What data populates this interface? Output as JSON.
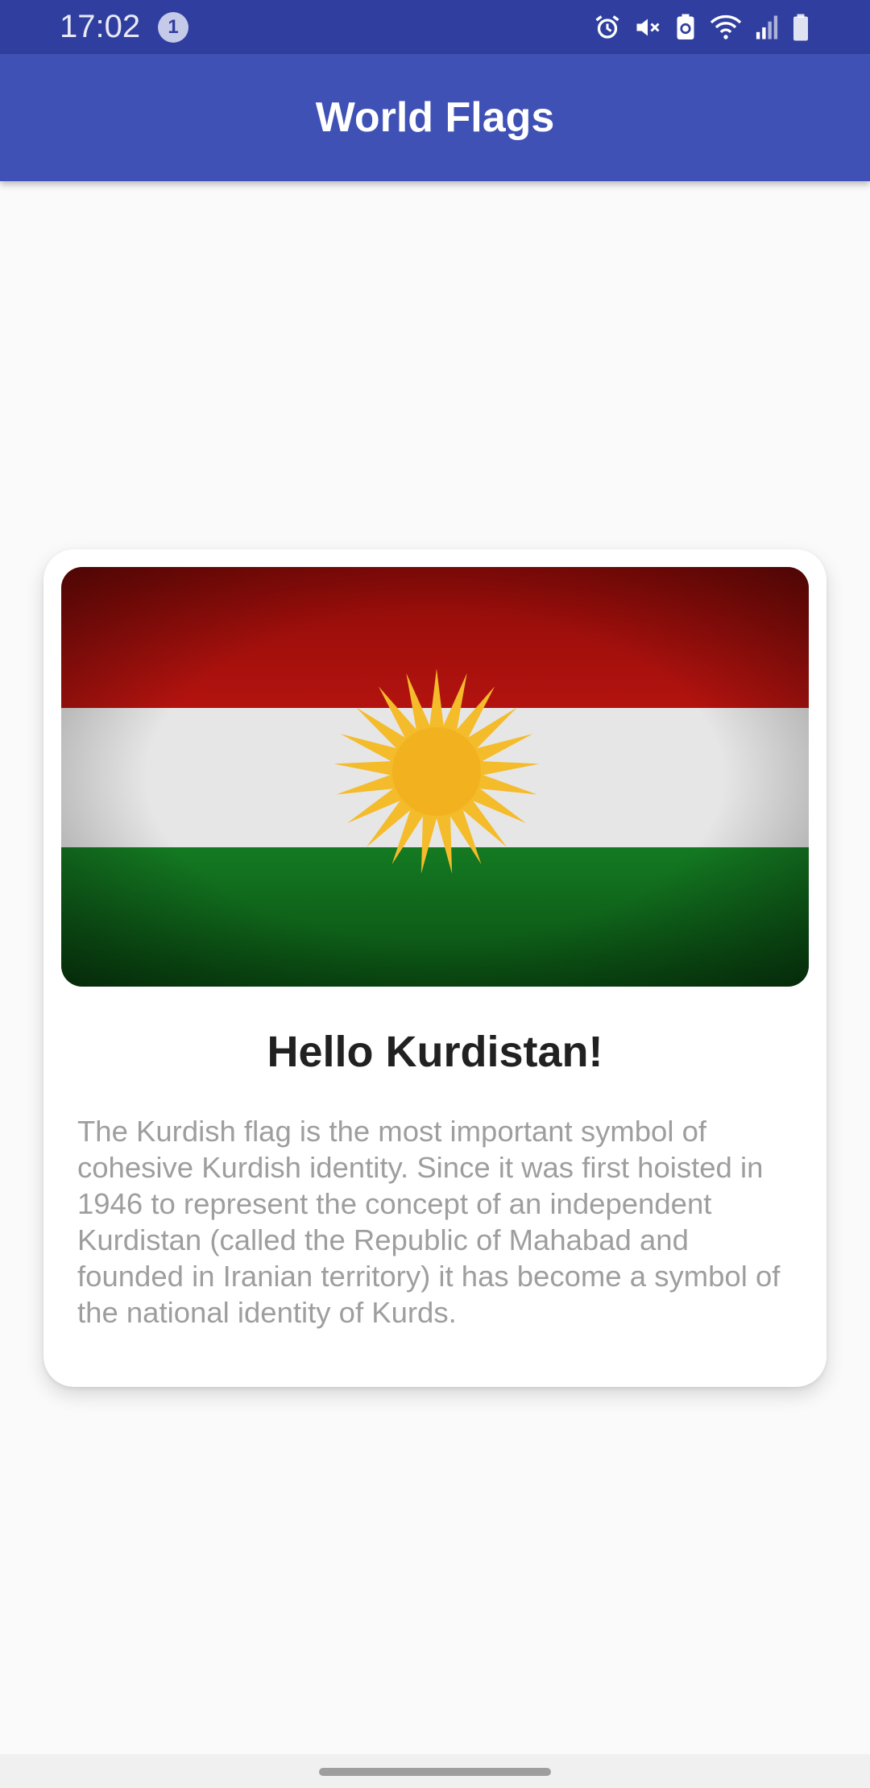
{
  "status_bar": {
    "time": "17:02",
    "notification_count": "1",
    "icons": [
      "alarm-icon",
      "mute-icon",
      "battery-saver-icon",
      "wifi-icon",
      "signal-icon",
      "battery-icon"
    ]
  },
  "app_bar": {
    "title": "World Flags"
  },
  "card": {
    "image": "kurdistan-flag-image",
    "title": "Hello Kurdistan!",
    "description": "The Kurdish flag is the most important symbol of cohesive Kurdish identity. Since it was first hoisted in 1946 to represent the concept of an independent Kurdistan (called the Republic of Mahabad and founded in Iranian territory) it has become a symbol of the national identity of Kurds."
  },
  "colors": {
    "status_bar": "#303f9f",
    "app_bar": "#3f51b5",
    "flag_red": "#a50f0c",
    "flag_white": "#ececec",
    "flag_green": "#12701e",
    "flag_sun": "#f4bb2a",
    "description_text": "#9e9e9e"
  }
}
